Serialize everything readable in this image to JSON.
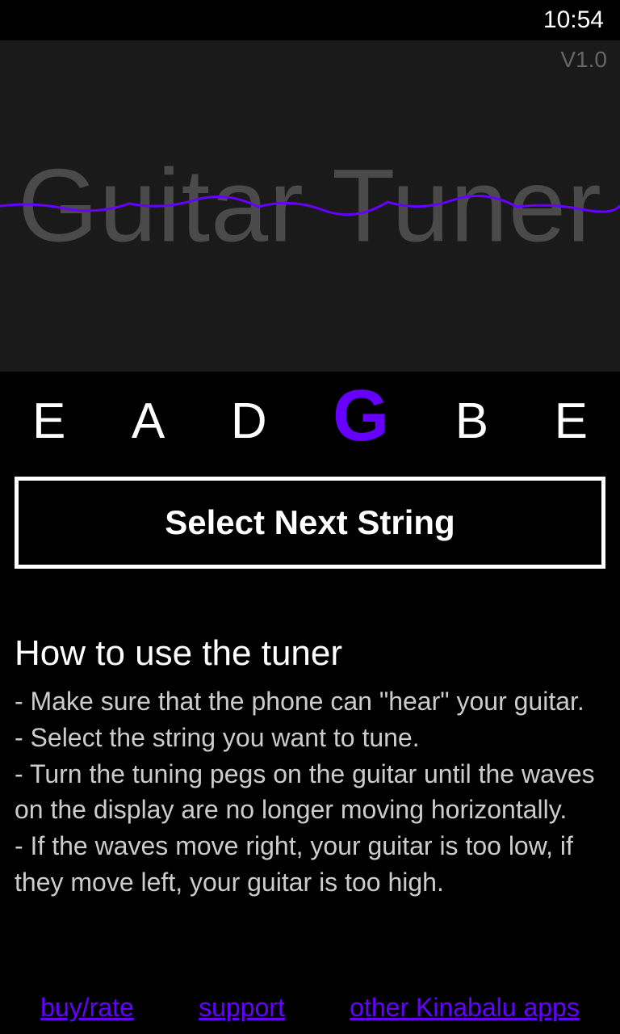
{
  "status": {
    "time": "10:54"
  },
  "header": {
    "version": "V1.0",
    "app_title": "Guitar Tuner"
  },
  "strings": {
    "items": [
      "E",
      "A",
      "D",
      "G",
      "B",
      "E"
    ],
    "active_index": 3
  },
  "buttons": {
    "next_string": "Select Next String"
  },
  "instructions": {
    "title": "How to use the tuner",
    "line1": "- Make sure that the phone can \"hear\" your guitar.",
    "line2": "- Select the string you want to tune.",
    "line3": "- Turn the tuning pegs on the guitar until the waves on the display are no longer moving horizontally.",
    "line4": "- If the waves move right, your guitar is too low, if they move left, your guitar is too high."
  },
  "links": {
    "buy_rate": "buy/rate",
    "support": "support",
    "other_apps": "other Kinabalu apps"
  },
  "colors": {
    "accent": "#6600ff",
    "bg_dark": "#000",
    "bg_wave": "#1a1a1a"
  }
}
